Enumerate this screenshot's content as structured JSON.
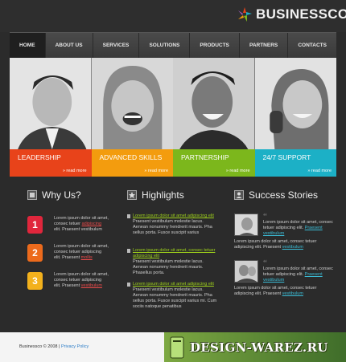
{
  "brand": {
    "name": "BUSINESSCO"
  },
  "nav": [
    {
      "label": "HOME"
    },
    {
      "label": "ABOUT US"
    },
    {
      "label": "SERVICES"
    },
    {
      "label": "SOLUTIONS"
    },
    {
      "label": "PRODUCTS"
    },
    {
      "label": "PARTNERS"
    },
    {
      "label": "CONTACTS"
    }
  ],
  "hero": [
    {
      "title": "LEADERSHIP",
      "more": "» read more",
      "color": "#e8431a"
    },
    {
      "title": "ADVANCED SKILLS",
      "more": "» read more",
      "color": "#f39c0e"
    },
    {
      "title": "PARTNERSHIP",
      "more": "» read more",
      "color": "#7cb71c"
    },
    {
      "title": "24/7 SUPPORT",
      "more": "» read more",
      "color": "#1cb0c6"
    }
  ],
  "why": {
    "title": "Why Us?",
    "items": [
      {
        "num": "1",
        "color": "#e0263c",
        "text": "Lorem ipsum dolor sit amet, consec tetuer",
        "link": "adipiscing",
        "tail": "elit. Praesent vestibulum"
      },
      {
        "num": "2",
        "color": "#ec6a1c",
        "text": "Lorem ipsum dolor sit amet, consec tetuer adipiscing elit. Praesent",
        "link": "mollis",
        "tail": ""
      },
      {
        "num": "3",
        "color": "#f3b11c",
        "text": "Lorem ipsum dolor sit amet, consec tetuer adipiscing elit. Praesent",
        "link": "vestibulum",
        "tail": ""
      }
    ]
  },
  "highlights": {
    "title": "Highlights",
    "items": [
      {
        "link": "Lorem ipsum dolor sit amet adipiscing elit",
        "text": "Praesent vestibulum molestie lacus. Aenean nonummy hendrerit mauris. Pha sellus porta. Fusce suscipit varius"
      },
      {
        "link": "Lorem ipsum dolor sit amet, consec tetuer adipiscing elit",
        "text": "Praesent vestibulum molestie lacus. Aenean nonummy hendrerit mauris. Phasellus porta."
      },
      {
        "link": "Lorem ipsum dolor sit amet adipiscing elit",
        "text": "Praesent vestibulum molestie lacus. Aenean nonummy hendrerit mauris. Pha sellus porta. Fusce suscipit varius mi. Cum sociis natoque penatibus"
      }
    ]
  },
  "stories": {
    "title": "Success Stories",
    "items": [
      {
        "top": "Lorem ipsum dolor sit amet, consec tetuer adipiscing elit.",
        "link": "Praesent vestibulum",
        "bottom": "Lorem ipsum dolor sit amet, consec tetuer adipiscing elit. Praesent",
        "blink": "vestibulum"
      },
      {
        "top": "Lorem ipsum dolor sit amet, consec tetuer adipiscing elit.",
        "link": "Praesent vestibulum",
        "bottom": "Lorem ipsum dolor sit amet, consec tetuer adipiscing elit. Praesent",
        "blink": "vestibulum"
      }
    ]
  },
  "footer": {
    "text": "Businessco © 2008 |",
    "link": "Privacy Policy"
  },
  "watermark": {
    "text": "DESIGN-WAREZ.RU"
  }
}
